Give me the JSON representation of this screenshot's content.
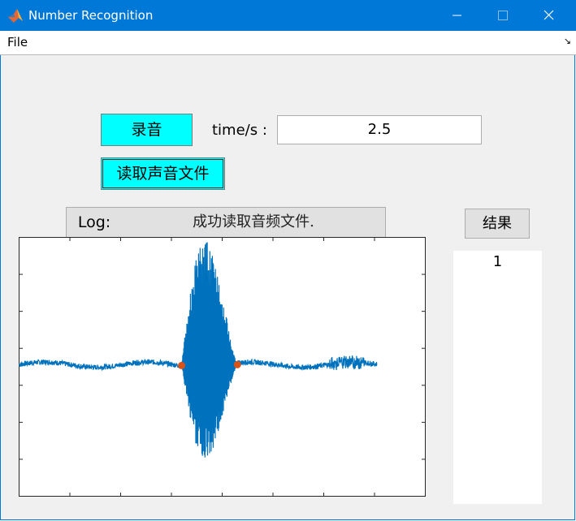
{
  "window": {
    "title": "Number Recognition"
  },
  "menu": {
    "file": "File",
    "overflow_arrow": "↘"
  },
  "controls": {
    "record_button": "录音",
    "read_file_button": "读取声音文件",
    "time_label": "time/s :",
    "time_value": "2.5"
  },
  "log": {
    "label": "Log:",
    "message": "成功读取音频文件."
  },
  "result": {
    "button": "结果",
    "value": "1"
  },
  "colors": {
    "titlebar": "#0078d7",
    "cyan_button": "#00ffff",
    "waveform": "#0072bd",
    "marker": "#d95319"
  },
  "chart_data": {
    "type": "line",
    "title": "",
    "xlabel": "",
    "ylabel": "",
    "x_range": [
      0,
      8
    ],
    "y_range": [
      -3,
      3
    ],
    "x_tick_count": 8,
    "y_tick_count": 6,
    "tick_labels_shown": false,
    "grid": false,
    "series": [
      {
        "description": "audio waveform; near-zero noise baseline with a loud burst between the two markers",
        "baseline_level": 0.05,
        "burst_start_x": 3.2,
        "burst_end_x": 4.3,
        "burst_max": 2.9,
        "burst_min": -2.2,
        "signal_end_x": 7.05
      }
    ],
    "markers": [
      {
        "x": 3.2,
        "y": 0.03
      },
      {
        "x": 4.3,
        "y": 0.05
      }
    ]
  }
}
